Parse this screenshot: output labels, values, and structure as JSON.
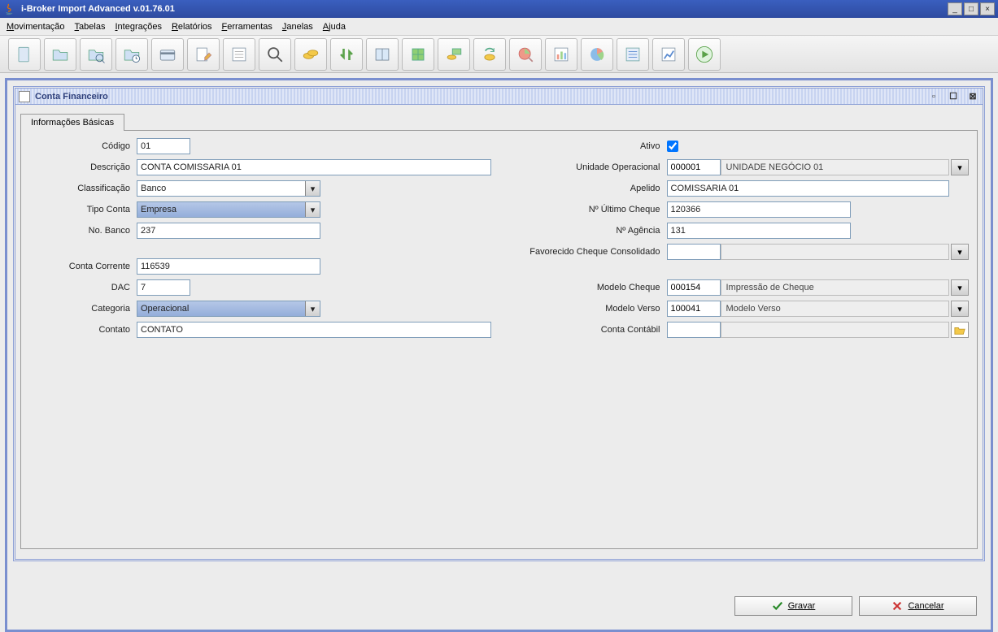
{
  "window": {
    "title": "i-Broker Import Advanced v.01.76.01"
  },
  "menubar": {
    "items": [
      "Movimentação",
      "Tabelas",
      "Integrações",
      "Relatórios",
      "Ferramentas",
      "Janelas",
      "Ajuda"
    ]
  },
  "toolbar": {
    "icons": [
      "document-icon",
      "folder-icon",
      "folder-search-icon",
      "folder-clock-icon",
      "card-icon",
      "edit-icon",
      "list-icon",
      "magnifier-icon",
      "coins-icon",
      "exchange-icon",
      "book-icon",
      "table-icon",
      "money-icon",
      "refresh-money-icon",
      "pie-edit-icon",
      "barchart-icon",
      "piechart-icon",
      "bluelist-icon",
      "diagram-icon",
      "play-icon"
    ]
  },
  "iwindow": {
    "title": "Conta Financeiro"
  },
  "tab": {
    "label": "Informações Básicas"
  },
  "fields": {
    "codigo_label": "Código",
    "codigo_value": "01",
    "descricao_label": "Descrição",
    "descricao_value": "CONTA COMISSARIA 01",
    "classificacao_label": "Classificação",
    "classificacao_value": "Banco",
    "tipo_conta_label": "Tipo Conta",
    "tipo_conta_value": "Empresa",
    "no_banco_label": "No. Banco",
    "no_banco_value": "237",
    "conta_corrente_label": "Conta Corrente",
    "conta_corrente_value": "116539",
    "dac_label": "DAC",
    "dac_value": "7",
    "categoria_label": "Categoria",
    "categoria_value": "Operacional",
    "contato_label": "Contato",
    "contato_value": "CONTATO",
    "ativo_label": "Ativo",
    "ativo_checked": true,
    "unidade_operacional_label": "Unidade Operacional",
    "unidade_operacional_code": "000001",
    "unidade_operacional_name": "UNIDADE NEGÓCIO 01",
    "apelido_label": "Apelido",
    "apelido_value": "COMISSARIA 01",
    "ultimo_cheque_label": "Nº Último Cheque",
    "ultimo_cheque_value": "120366",
    "agencia_label": "Nº Agência",
    "agencia_value": "131",
    "favorecido_label": "Favorecido Cheque Consolidado",
    "favorecido_code": "",
    "favorecido_name": "",
    "modelo_cheque_label": "Modelo Cheque",
    "modelo_cheque_code": "000154",
    "modelo_cheque_name": "Impressão de Cheque",
    "modelo_verso_label": "Modelo Verso",
    "modelo_verso_code": "100041",
    "modelo_verso_name": "Modelo Verso",
    "conta_contabil_label": "Conta Contábil",
    "conta_contabil_code": "",
    "conta_contabil_name": ""
  },
  "buttons": {
    "save": "Gravar",
    "cancel": "Cancelar"
  }
}
